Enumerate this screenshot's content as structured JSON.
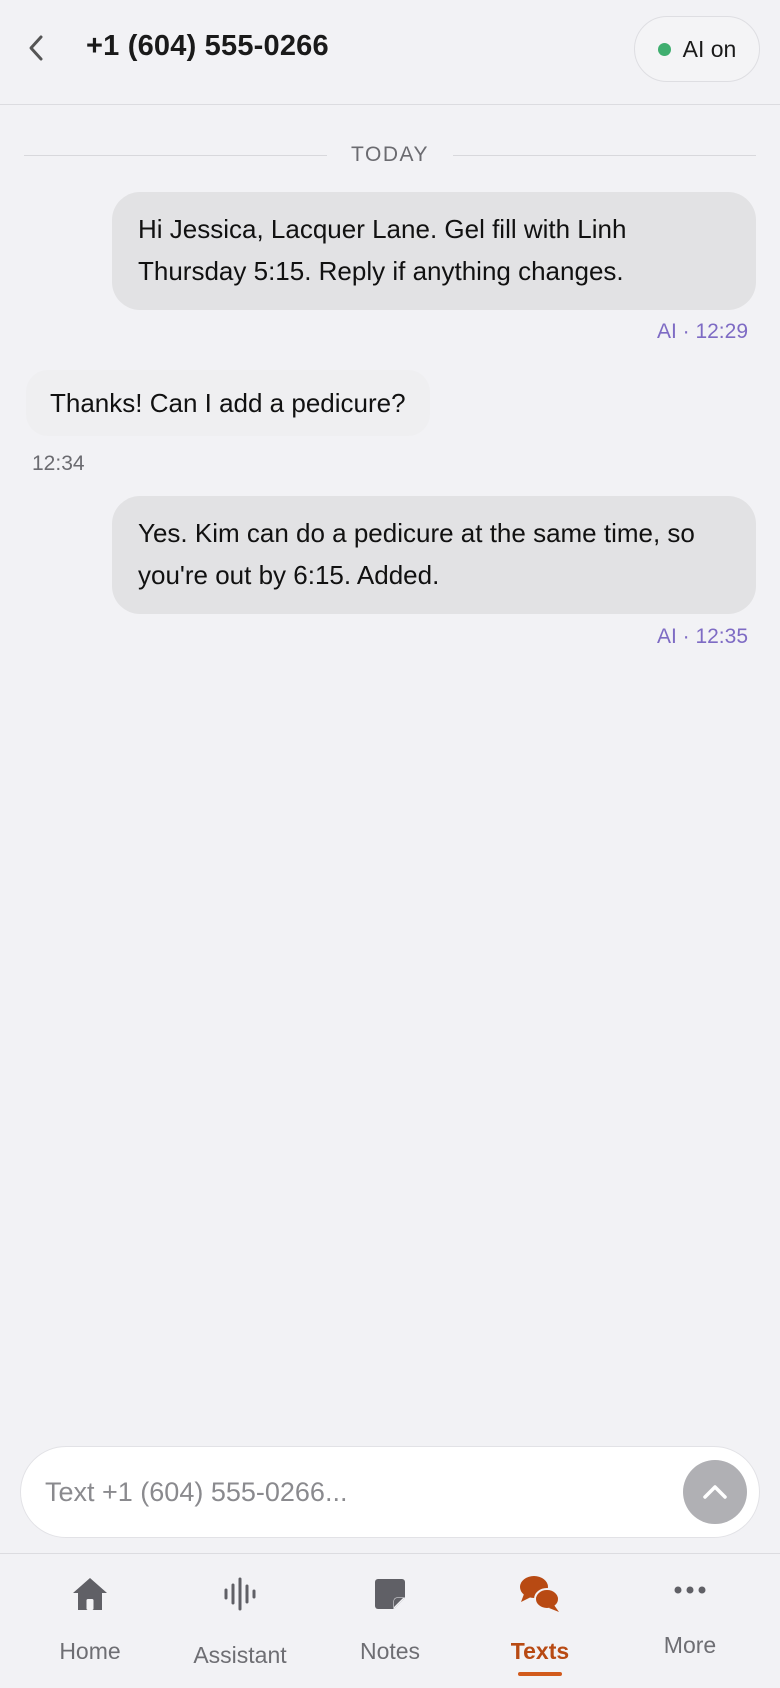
{
  "header": {
    "title": "+1 (604) 555-0266",
    "back_icon": "chevron-left-icon",
    "ai_status": {
      "label": "AI on",
      "dot_color": "#3fae6f"
    }
  },
  "thread": {
    "day_label": "TODAY",
    "messages": [
      {
        "direction": "outgoing",
        "text": "Hi Jessica, Lacquer Lane. Gel fill with Linh Thursday 5:15. Reply if anything changes.",
        "meta": "AI · 12:29"
      },
      {
        "direction": "incoming",
        "text": "Thanks! Can I add a pedicure?",
        "meta": "12:34"
      },
      {
        "direction": "outgoing",
        "text": "Yes. Kim can do a pedicure at the same time, so you're out by 6:15. Added.",
        "meta": "AI · 12:35"
      }
    ]
  },
  "composer": {
    "placeholder": "Text +1 (604) 555-0266...",
    "value": "",
    "send_icon": "chevron-up-icon"
  },
  "tabbar": {
    "active": "Texts",
    "accent_color": "#b84a13",
    "tabs": [
      {
        "label": "Home",
        "icon": "home-icon"
      },
      {
        "label": "Assistant",
        "icon": "waveform-icon"
      },
      {
        "label": "Notes",
        "icon": "note-icon"
      },
      {
        "label": "Texts",
        "icon": "chat-bubbles-icon"
      },
      {
        "label": "More",
        "icon": "more-dots-icon"
      }
    ]
  }
}
